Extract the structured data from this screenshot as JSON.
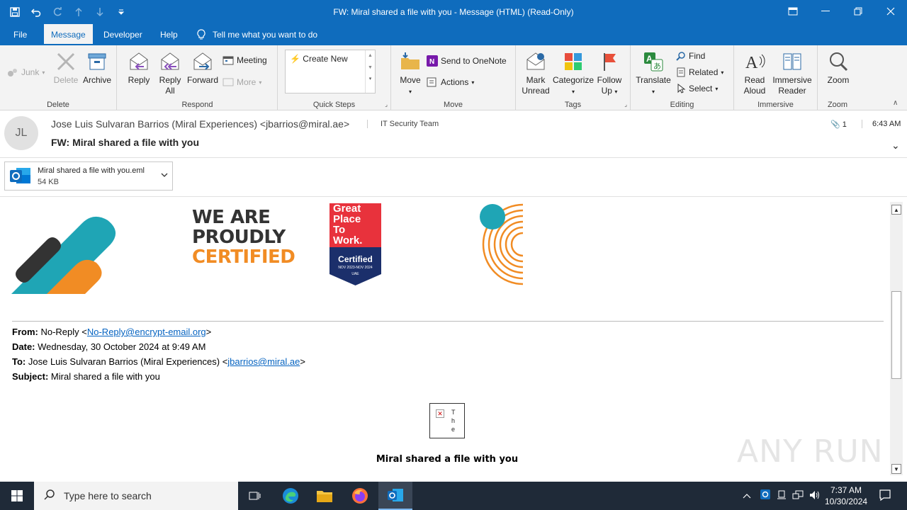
{
  "window": {
    "title": "FW: Miral shared a file with you  -  Message (HTML) (Read-Only)"
  },
  "tabs": [
    {
      "label": "File"
    },
    {
      "label": "Message"
    },
    {
      "label": "Developer"
    },
    {
      "label": "Help"
    }
  ],
  "tell_me": "Tell me what you want to do",
  "ribbon": {
    "delete_group": {
      "label": "Delete",
      "junk": "Junk",
      "delete": "Delete",
      "archive": "Archive"
    },
    "respond_group": {
      "label": "Respond",
      "reply": "Reply",
      "reply_all_1": "Reply",
      "reply_all_2": "All",
      "forward": "Forward",
      "meeting": "Meeting",
      "more": "More"
    },
    "quicksteps_group": {
      "label": "Quick Steps",
      "create_new": "Create New"
    },
    "move_group": {
      "label": "Move",
      "move": "Move",
      "send_onenote": "Send to OneNote",
      "actions": "Actions"
    },
    "tags_group": {
      "label": "Tags",
      "mark_unread_1": "Mark",
      "mark_unread_2": "Unread",
      "categorize": "Categorize",
      "follow_up_1": "Follow",
      "follow_up_2": "Up"
    },
    "editing_group": {
      "label": "Editing",
      "translate": "Translate",
      "find": "Find",
      "related": "Related",
      "select": "Select"
    },
    "immersive_group": {
      "label": "Immersive",
      "read_aloud_1": "Read",
      "read_aloud_2": "Aloud",
      "immersive_reader_1": "Immersive",
      "immersive_reader_2": "Reader"
    },
    "zoom_group": {
      "label": "Zoom",
      "zoom": "Zoom"
    }
  },
  "message": {
    "avatar_initials": "JL",
    "sender": "Jose Luis Sulvaran Barrios (Miral Experiences) <jbarrios@miral.ae>",
    "to": "IT Security Team",
    "subject": "FW: Miral shared a file with you",
    "attachment_count": "1",
    "time": "6:43 AM"
  },
  "attachment": {
    "name": "Miral shared a file with you.eml",
    "size": "54 KB"
  },
  "body": {
    "banner_line1": "WE ARE",
    "banner_line2": "PROUDLY",
    "banner_line3": "CERTIFIED",
    "gptw_1": "Great",
    "gptw_2": "Place",
    "gptw_3": "To",
    "gptw_4": "Work.",
    "gptw_5": "Certified",
    "gptw_6": "NOV 2023-NOV 2024",
    "gptw_7": "UAE",
    "from_label": "From:",
    "from_name": "No-Reply <",
    "from_email": "No-Reply@encrypt-email.org",
    "from_end": ">",
    "date_label": "Date:",
    "date_value": "Wednesday, 30 October 2024 at 9:49 AM",
    "to_label": "To:",
    "to_name": "Jose Luis Sulvaran Barrios (Miral Experiences) <",
    "to_email": "jbarrios@miral.ae",
    "to_end": ">",
    "subject_label": "Subject:",
    "subject_value": "Miral shared a file with you",
    "broken_text": "T h e",
    "shared_heading": "Miral shared a file with you"
  },
  "watermark": "ANY RUN",
  "taskbar": {
    "search_placeholder": "Type here to search",
    "time": "7:37 AM",
    "date": "10/30/2024"
  }
}
